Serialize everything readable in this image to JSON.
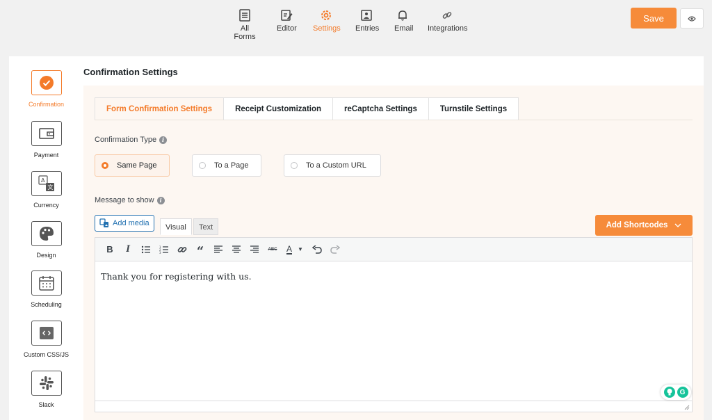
{
  "colors": {
    "accent": "#f47b2a",
    "save_bg": "#f68b3a",
    "link_blue": "#2271b1",
    "content_bg": "#fdf7f2"
  },
  "topnav": {
    "items": [
      {
        "label": "All Forms",
        "icon": "list-form-icon"
      },
      {
        "label": "Editor",
        "icon": "edit-icon"
      },
      {
        "label": "Settings",
        "icon": "gear-icon",
        "active": true
      },
      {
        "label": "Entries",
        "icon": "entries-icon"
      },
      {
        "label": "Email",
        "icon": "bell-icon"
      },
      {
        "label": "Integrations",
        "icon": "link-icon"
      }
    ],
    "save_label": "Save",
    "preview_icon": "eye-icon"
  },
  "sidebar": {
    "items": [
      {
        "label": "Confirmation",
        "icon": "check-circle-icon",
        "active": true
      },
      {
        "label": "Payment",
        "icon": "wallet-icon"
      },
      {
        "label": "Currency",
        "icon": "translate-icon"
      },
      {
        "label": "Design",
        "icon": "palette-icon"
      },
      {
        "label": "Scheduling",
        "icon": "calendar-icon"
      },
      {
        "label": "Custom CSS/JS",
        "icon": "code-icon"
      },
      {
        "label": "Slack",
        "icon": "slack-icon"
      }
    ]
  },
  "page": {
    "title": "Confirmation Settings"
  },
  "tabs": [
    {
      "label": "Form Confirmation Settings",
      "active": true
    },
    {
      "label": "Receipt Customization"
    },
    {
      "label": "reCaptcha Settings"
    },
    {
      "label": "Turnstile Settings"
    }
  ],
  "confirmation_type": {
    "label": "Confirmation Type",
    "options": [
      {
        "label": "Same Page",
        "selected": true
      },
      {
        "label": "To a Page"
      },
      {
        "label": "To a Custom URL"
      }
    ]
  },
  "message": {
    "label": "Message to show",
    "add_media_label": "Add media",
    "mode_visual": "Visual",
    "mode_text": "Text",
    "shortcodes_label": "Add Shortcodes",
    "toolbar": [
      "bold-icon",
      "italic-icon",
      "bullet-list-icon",
      "numbered-list-icon",
      "link-icon",
      "blockquote-icon",
      "align-left-icon",
      "align-center-icon",
      "align-right-icon",
      "strikethrough-icon",
      "text-color-icon",
      "undo-icon",
      "redo-icon"
    ],
    "content": "Thank you for registering with us."
  }
}
